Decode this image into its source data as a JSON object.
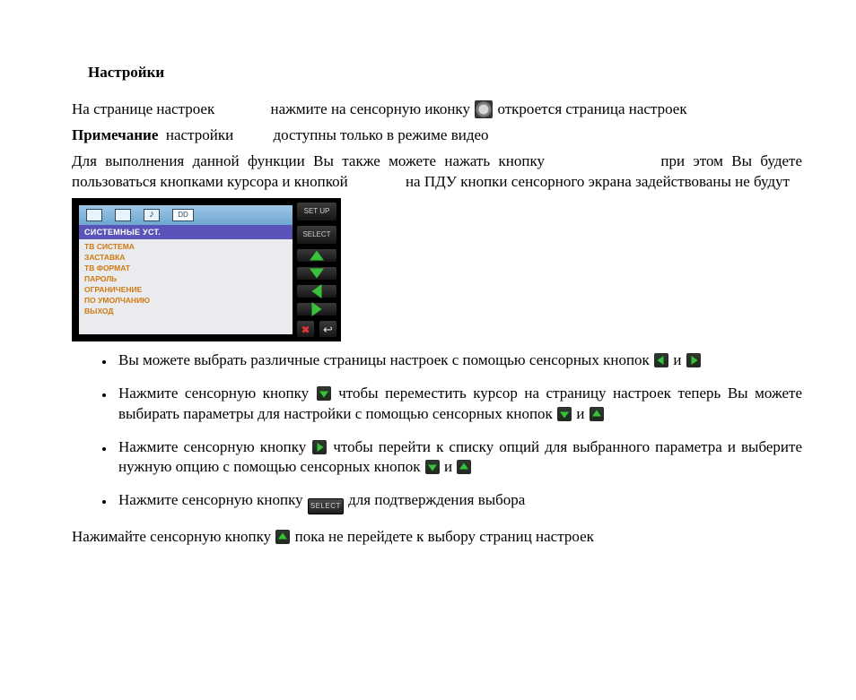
{
  "heading": "Настройки",
  "p1a": "На странице настроек",
  "p1b": "нажмите на сенсорную иконку",
  "p1c": "откроется страница настроек",
  "p2a": "Примечание",
  "p2b": "настройки",
  "p2c": "доступны только в режиме видео",
  "p3a": "Для выполнения данной функции Вы также можете нажать кнопку",
  "p3b": "при этом Вы будете пользоваться кнопками курсора и кнопкой",
  "p3c": "на ПДУ кнопки сенсорного экрана задействованы не будут",
  "device": {
    "setup": "SET UP",
    "select": "SELECT",
    "header": "СИСТЕМНЫЕ УСТ.",
    "dolby": "DD",
    "menu": [
      "ТВ СИСТЕМА",
      "ЗАСТАВКА",
      "ТВ ФОРМАТ",
      "ПАРОЛЬ",
      "ОГРАНИЧЕНИЕ",
      "ПО УМОЛЧАНИЮ",
      "ВЫХОД"
    ]
  },
  "li1a": "Вы можете выбрать различные страницы настроек с помощью сенсорных кнопок",
  "li1b": "и",
  "li2a": "Нажмите сенсорную кнопку",
  "li2b": "чтобы переместить курсор на страницу настроек теперь Вы можете выбирать параметры для настройки с помощью сенсорных кнопок",
  "li2c": "и",
  "li3a": "Нажмите сенсорную кнопку",
  "li3b": "чтобы перейти к списку опций для выбранного параметра и выберите нужную опцию с помощью сенсорных кнопок",
  "li3c": "и",
  "li4a": "Нажмите сенсорную кнопку",
  "li4b": "для подтверждения выбора",
  "selectLabel": "SELECT",
  "p4a": "Нажимайте сенсорную кнопку",
  "p4b": "пока не перейдете к выбору страниц настроек"
}
